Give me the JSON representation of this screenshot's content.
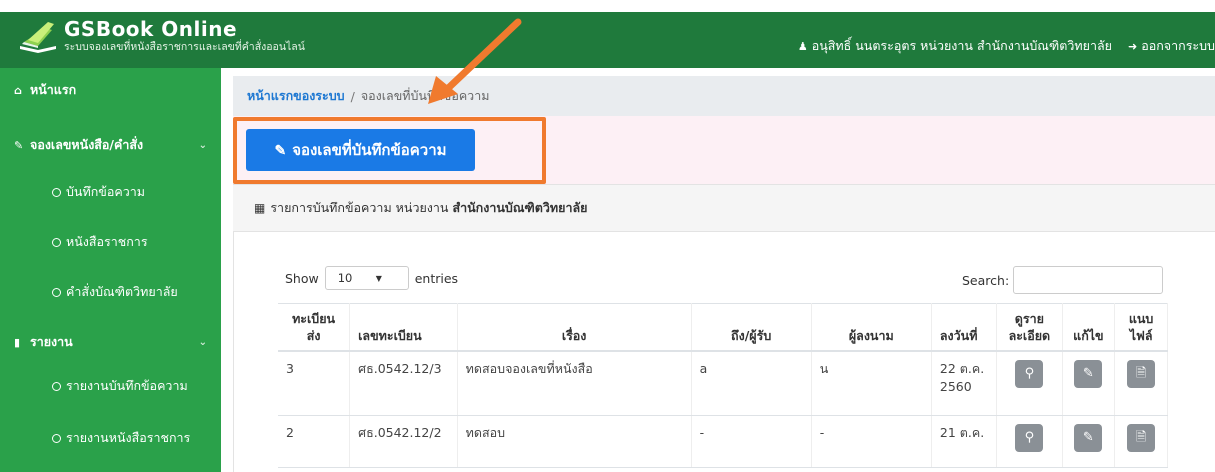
{
  "app": {
    "title": "GSBook Online",
    "subtitle": "ระบบจองเลขที่หนังสือราชการและเลขที่คำสั่งออนไลน์"
  },
  "user": {
    "name": "อนุสิทธิ์ นนตระอุตร หน่วยงาน สำนักงานบัณฑิตวิทยาลัย",
    "logout_label": "ออกจากระบบ"
  },
  "sidebar": {
    "items": [
      {
        "label": "หน้าแรก",
        "icon": "home-icon"
      },
      {
        "label": "จองเลขหนังสือ/คำสั่ง",
        "icon": "edit-icon"
      },
      {
        "label": "บันทึกข้อความ"
      },
      {
        "label": "หนังสือราชการ"
      },
      {
        "label": "คำสั่งบัณฑิตวิทยาลัย"
      },
      {
        "label": "รายงาน",
        "icon": "file-icon"
      },
      {
        "label": "รายงานบันทึกข้อความ"
      },
      {
        "label": "รายงานหนังสือราชการ"
      }
    ]
  },
  "breadcrumb": {
    "home": "หน้าแรกของระบบ",
    "current": "จองเลขที่บันทึกข้อความ"
  },
  "actions": {
    "book_button": "จองเลขที่บันทึกข้อความ"
  },
  "card": {
    "heading_prefix": "รายการบันทึกข้อความ หน่วยงาน",
    "heading_unit": "สำนักงานบัณฑิตวิทยาลัย"
  },
  "datatable": {
    "show_label": "Show",
    "entries_value": "10",
    "entries_label": "entries",
    "search_label": "Search:"
  },
  "table": {
    "headers": [
      "ทะเบียนส่ง",
      "เลขทะเบียน",
      "เรื่อง",
      "ถึง/ผู้รับ",
      "ผู้ลงนาม",
      "ลงวันที่",
      "ดูรายละเอียด",
      "แก้ไข",
      "แนบไฟล์"
    ],
    "header_lines": {
      "reg": [
        "ทะเบียน",
        "ส่ง"
      ],
      "detail": [
        "ดูราย",
        "ละเอียด"
      ],
      "attach": [
        "แนบ",
        "ไฟล์"
      ]
    },
    "rows": [
      {
        "reg": "3",
        "number": "ศธ.0542.12/3",
        "subject": "ทดสอบจองเลขที่หนังสือ",
        "to": "a",
        "signer": "น",
        "date": "22 ต.ค. 2560"
      },
      {
        "reg": "2",
        "number": "ศธ.0542.12/2",
        "subject": "ทดสอบ",
        "to": "-",
        "signer": "-",
        "date": "21 ต.ค."
      }
    ]
  },
  "colors": {
    "header_bg": "#1f7a3c",
    "sidebar_bg": "#2aa14a",
    "primary": "#1a7ae6",
    "highlight": "#f07a2e"
  }
}
